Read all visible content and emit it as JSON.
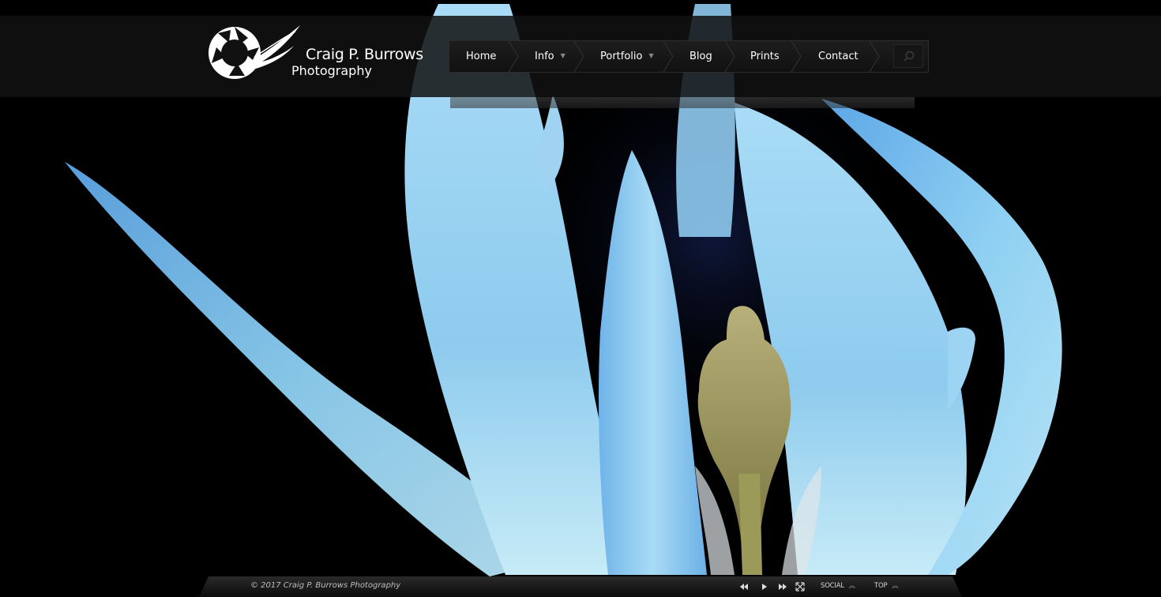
{
  "site": {
    "title": "Craig P. Burrows",
    "subtitle": "Photography"
  },
  "nav": {
    "items": [
      {
        "label": "Home"
      },
      {
        "label": "Info"
      },
      {
        "label": "Portfolio"
      },
      {
        "label": "Blog"
      },
      {
        "label": "Prints"
      },
      {
        "label": "Contact"
      }
    ],
    "search_icon": "search-icon"
  },
  "footer": {
    "copyright": "© 2017 Craig P. Burrows Photography",
    "controls": [
      "previous-icon",
      "play-icon",
      "next-icon",
      "fullscreen-icon"
    ],
    "social_label": "SOCIAL",
    "top_label": "TOP"
  },
  "colors": {
    "background": "#000000",
    "petal": "#7fc4f0",
    "petal_light": "#c6e6fb",
    "stamen": "#8f8a4c"
  }
}
